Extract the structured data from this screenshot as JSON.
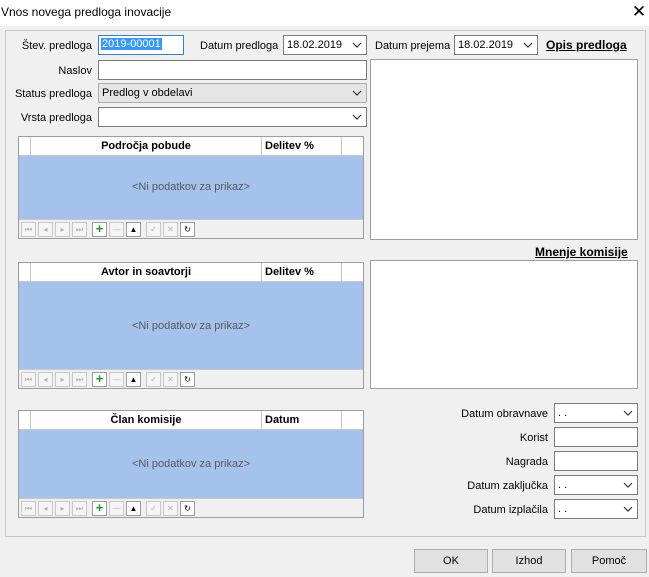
{
  "window": {
    "title": "Vnos novega predloga inovacije",
    "close_glyph": "✕"
  },
  "form": {
    "stev_label": "Štev. predloga",
    "stev_value": "2019-00001",
    "datum_predloga_label": "Datum predloga",
    "datum_predloga_value": "18.02.2019",
    "datum_prejema_label": "Datum prejema",
    "datum_prejema_value": "18.02.2019",
    "naslov_label": "Naslov",
    "naslov_value": "",
    "status_label": "Status predloga",
    "status_value": "Predlog v obdelavi",
    "vrsta_label": "Vrsta predloga",
    "vrsta_value": ""
  },
  "opis_header": "Opis predloga",
  "mnenje_header": "Mnenje komisije",
  "grids": {
    "podrocja": {
      "col1": "Področja pobude",
      "col2": "Delitev %",
      "empty": "<Ni podatkov za prikaz>"
    },
    "avtor": {
      "col1": "Avtor in soavtorji",
      "col2": "Delitev %",
      "empty": "<Ni podatkov za prikaz>"
    },
    "komisija": {
      "col1": "Član komisije",
      "col2": "Datum",
      "empty": "<Ni podatkov za prikaz>"
    }
  },
  "navigator": {
    "first": "⏮",
    "prev_page": "◂",
    "next_page": "▸",
    "last": "⏭",
    "add": "+",
    "delete": "—",
    "edit": "▲",
    "post": "✓",
    "cancel": "✕",
    "refresh": "↻"
  },
  "right_fields": {
    "datum_obravnave_label": "Datum obravnave",
    "datum_obravnave_value": " .  .",
    "korist_label": "Korist",
    "korist_value": "",
    "nagrada_label": "Nagrada",
    "nagrada_value": "",
    "datum_zakljucka_label": "Datum zaključka",
    "datum_zakljucka_value": " .  .",
    "datum_izplacila_label": "Datum izplačila",
    "datum_izplacila_value": " .  ."
  },
  "buttons": {
    "ok": "OK",
    "izhod": "Izhod",
    "pomoc": "Pomoč"
  },
  "colors": {
    "grid_body": "#a4c2eb",
    "selection": "#3399ff",
    "add_icon": "#1a9a1a"
  }
}
